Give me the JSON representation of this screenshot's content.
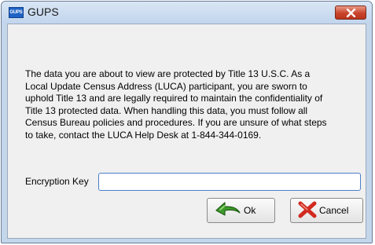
{
  "window": {
    "title": "GUPS",
    "app_icon_text": "GUPS",
    "app_icon": "gups-app-icon",
    "close_icon": "close-icon"
  },
  "message": "The data you are about to view are protected by Title 13 U.S.C.  As a\nLocal Update Census Address (LUCA) participant, you are sworn to\nuphold Title 13 and are legally required to maintain the confidentiality of\nTitle 13 protected data. When handling this data, you must follow all\nCensus Bureau policies and procedures. If you are unsure of what steps\nto take, contact the LUCA Help Desk at 1-844-344-0169.",
  "encryption_key": {
    "label": "Encryption Key",
    "value": "",
    "placeholder": ""
  },
  "buttons": {
    "ok_label": "Ok",
    "ok_icon": "green-arrow-icon",
    "cancel_label": "Cancel",
    "cancel_icon": "red-x-icon"
  },
  "colors": {
    "titlebar": "#c2d5ec",
    "close_button": "#c9442b",
    "input_border": "#4a7fc7",
    "ok_arrow": "#3f9a2c",
    "cancel_x": "#d12a1f"
  }
}
